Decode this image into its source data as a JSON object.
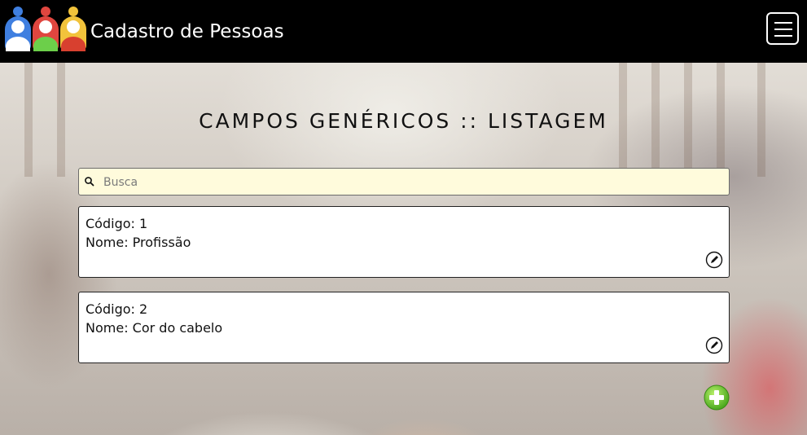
{
  "header": {
    "app_title": "Cadastro de Pessoas",
    "menu_icon": "hamburger-icon",
    "logo_icon": "people-group-icon"
  },
  "main": {
    "page_title": "CAMPOS GENÉRICOS :: LISTAGEM",
    "search": {
      "placeholder": "Busca",
      "value": "",
      "icon": "search-icon"
    },
    "records": [
      {
        "code_label": "Código: 1",
        "name_label": "Nome: Profissão",
        "edit_icon": "pencil-icon"
      },
      {
        "code_label": "Código: 2",
        "name_label": "Nome: Cor do cabelo",
        "edit_icon": "pencil-icon"
      }
    ],
    "add_icon": "plus-circle-icon"
  },
  "colors": {
    "header_bg": "#000000",
    "search_bg": "#fffbdc",
    "add_button": "#7bd23a"
  }
}
